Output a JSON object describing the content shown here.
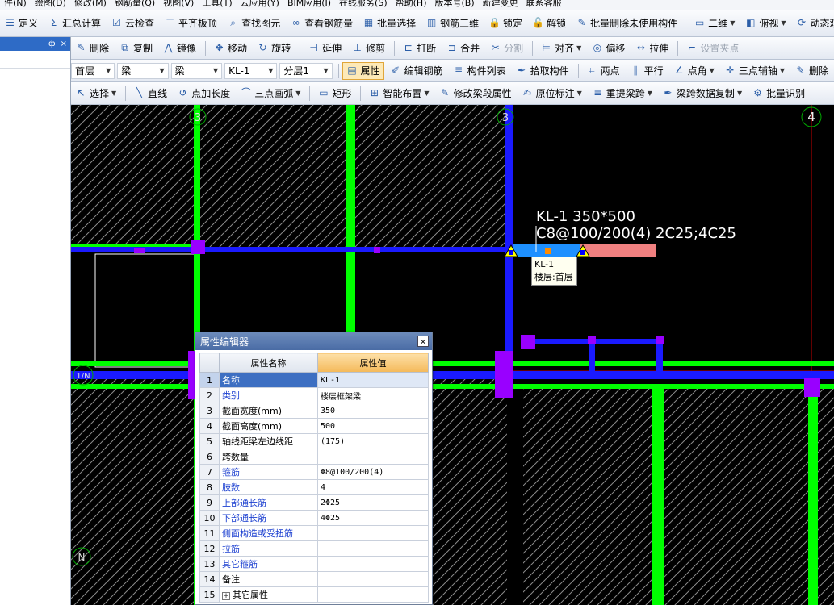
{
  "menubar": [
    "件(N)",
    "绘图(D)",
    "修改(M)",
    "钢筋量(Q)",
    "视图(V)",
    "工具(T)",
    "云应用(Y)",
    "BIM应用(I)",
    "在线服务(S)",
    "帮助(H)",
    "版本号(B)",
    "新建变更",
    "联系客服"
  ],
  "toolbar1": [
    {
      "label": "定义",
      "icon": "define-icon"
    },
    {
      "label": "汇总计算",
      "icon": "sigma-icon"
    },
    {
      "label": "云检查",
      "icon": "cloud-check-icon"
    },
    {
      "label": "平齐板顶",
      "icon": "align-top-icon"
    },
    {
      "label": "查找图元",
      "icon": "find-element-icon"
    },
    {
      "label": "查看钢筋量",
      "icon": "view-rebar-icon"
    },
    {
      "label": "批量选择",
      "icon": "batch-select-icon"
    },
    {
      "label": "钢筋三维",
      "icon": "rebar-3d-icon"
    },
    {
      "label": "锁定",
      "icon": "lock-icon"
    },
    {
      "label": "解锁",
      "icon": "unlock-icon"
    },
    {
      "label": "批量删除未使用构件",
      "icon": "batch-delete-icon"
    },
    {
      "label": "二维",
      "icon": "2d-view-icon"
    },
    {
      "label": "俯视",
      "icon": "top-view-icon"
    },
    {
      "label": "动态观察",
      "icon": "orbit-icon"
    }
  ],
  "toolbar2": [
    {
      "label": "删除",
      "icon": "delete-icon",
      "disabled": false
    },
    {
      "label": "复制",
      "icon": "copy-icon",
      "disabled": false
    },
    {
      "label": "镜像",
      "icon": "mirror-icon",
      "disabled": false
    },
    {
      "label": "移动",
      "icon": "move-icon",
      "disabled": false
    },
    {
      "label": "旋转",
      "icon": "rotate-icon",
      "disabled": false
    },
    {
      "label": "延伸",
      "icon": "extend-icon",
      "disabled": false
    },
    {
      "label": "修剪",
      "icon": "trim-icon",
      "disabled": false
    },
    {
      "label": "打断",
      "icon": "break-icon",
      "disabled": false
    },
    {
      "label": "合并",
      "icon": "merge-icon",
      "disabled": false
    },
    {
      "label": "分割",
      "icon": "split-icon",
      "disabled": true
    },
    {
      "label": "对齐",
      "icon": "align-icon",
      "disabled": false
    },
    {
      "label": "偏移",
      "icon": "offset-icon",
      "disabled": false
    },
    {
      "label": "拉伸",
      "icon": "stretch-icon",
      "disabled": false
    },
    {
      "label": "设置夹点",
      "icon": "grip-icon",
      "disabled": true
    }
  ],
  "selectors": {
    "floor": "首层",
    "category": "梁",
    "type": "梁",
    "member": "KL-1",
    "layer": "分层1"
  },
  "toolbar3": [
    {
      "label": "属性",
      "icon": "property-icon",
      "active": true
    },
    {
      "label": "编辑钢筋",
      "icon": "edit-rebar-icon",
      "active": false
    },
    {
      "label": "构件列表",
      "icon": "member-list-icon",
      "active": false
    },
    {
      "label": "拾取构件",
      "icon": "pick-member-icon",
      "active": false
    },
    {
      "label": "两点",
      "icon": "two-point-icon",
      "active": false
    },
    {
      "label": "平行",
      "icon": "parallel-icon",
      "active": false
    },
    {
      "label": "点角",
      "icon": "point-angle-icon",
      "active": false
    },
    {
      "label": "三点辅轴",
      "icon": "three-point-axis-icon",
      "active": false
    },
    {
      "label": "删除",
      "icon": "delete-axis-icon",
      "active": false
    }
  ],
  "toolbar4": [
    {
      "label": "选择",
      "icon": "cursor-icon"
    },
    {
      "label": "直线",
      "icon": "line-icon"
    },
    {
      "label": "点加长度",
      "icon": "point-length-icon"
    },
    {
      "label": "三点画弧",
      "icon": "arc-icon"
    },
    {
      "label": "矩形",
      "icon": "rectangle-icon"
    },
    {
      "label": "智能布置",
      "icon": "smart-layout-icon"
    },
    {
      "label": "修改梁段属性",
      "icon": "modify-beam-icon"
    },
    {
      "label": "原位标注",
      "icon": "in-situ-label-icon"
    },
    {
      "label": "重提梁跨",
      "icon": "re-extract-span-icon"
    },
    {
      "label": "梁跨数据复制",
      "icon": "span-copy-icon"
    },
    {
      "label": "批量识别",
      "icon": "batch-recognize-icon"
    }
  ],
  "canvas": {
    "axis_labels": [
      "3",
      "3",
      "4",
      "1/N",
      "N"
    ],
    "beam_label_line1": "KL-1 350*500",
    "beam_label_line2": "C8@100/200(4) 2C25;4C25",
    "tooltip_line1": "KL-1",
    "tooltip_line2": "楼层:首层",
    "colors": {
      "column": "#9900ff",
      "wall": "#00ff00",
      "beam": "#1a1aff",
      "highlight": "#ff00ff"
    }
  },
  "property_editor": {
    "title": "属性编辑器",
    "col_name": "属性名称",
    "col_value": "属性值",
    "close": "×",
    "rows": [
      {
        "num": "1",
        "name": "名称",
        "value": "KL-1",
        "blue": false,
        "selected": true
      },
      {
        "num": "2",
        "name": "类别",
        "value": "楼层框架梁",
        "blue": true,
        "selected": false
      },
      {
        "num": "3",
        "name": "截面宽度(mm)",
        "value": "350",
        "blue": false,
        "selected": false
      },
      {
        "num": "4",
        "name": "截面高度(mm)",
        "value": "500",
        "blue": false,
        "selected": false
      },
      {
        "num": "5",
        "name": "轴线距梁左边线距",
        "value": "(175)",
        "blue": false,
        "selected": false
      },
      {
        "num": "6",
        "name": "跨数量",
        "value": "",
        "blue": false,
        "selected": false
      },
      {
        "num": "7",
        "name": "箍筋",
        "value": "Φ8@100/200(4)",
        "blue": true,
        "selected": false
      },
      {
        "num": "8",
        "name": "肢数",
        "value": "4",
        "blue": true,
        "selected": false
      },
      {
        "num": "9",
        "name": "上部通长筋",
        "value": "2Φ25",
        "blue": true,
        "selected": false
      },
      {
        "num": "10",
        "name": "下部通长筋",
        "value": "4Φ25",
        "blue": true,
        "selected": false
      },
      {
        "num": "11",
        "name": "侧面构造或受扭筋",
        "value": "",
        "blue": true,
        "selected": false
      },
      {
        "num": "12",
        "name": "拉筋",
        "value": "",
        "blue": true,
        "selected": false
      },
      {
        "num": "13",
        "name": "其它箍筋",
        "value": "",
        "blue": true,
        "selected": false
      },
      {
        "num": "14",
        "name": "备注",
        "value": "",
        "blue": false,
        "selected": false
      },
      {
        "num": "15",
        "name": "其它属性",
        "value": "",
        "blue": false,
        "selected": false,
        "expander": "+"
      }
    ]
  },
  "left_panel": {
    "pin": "ф",
    "close": "×"
  }
}
